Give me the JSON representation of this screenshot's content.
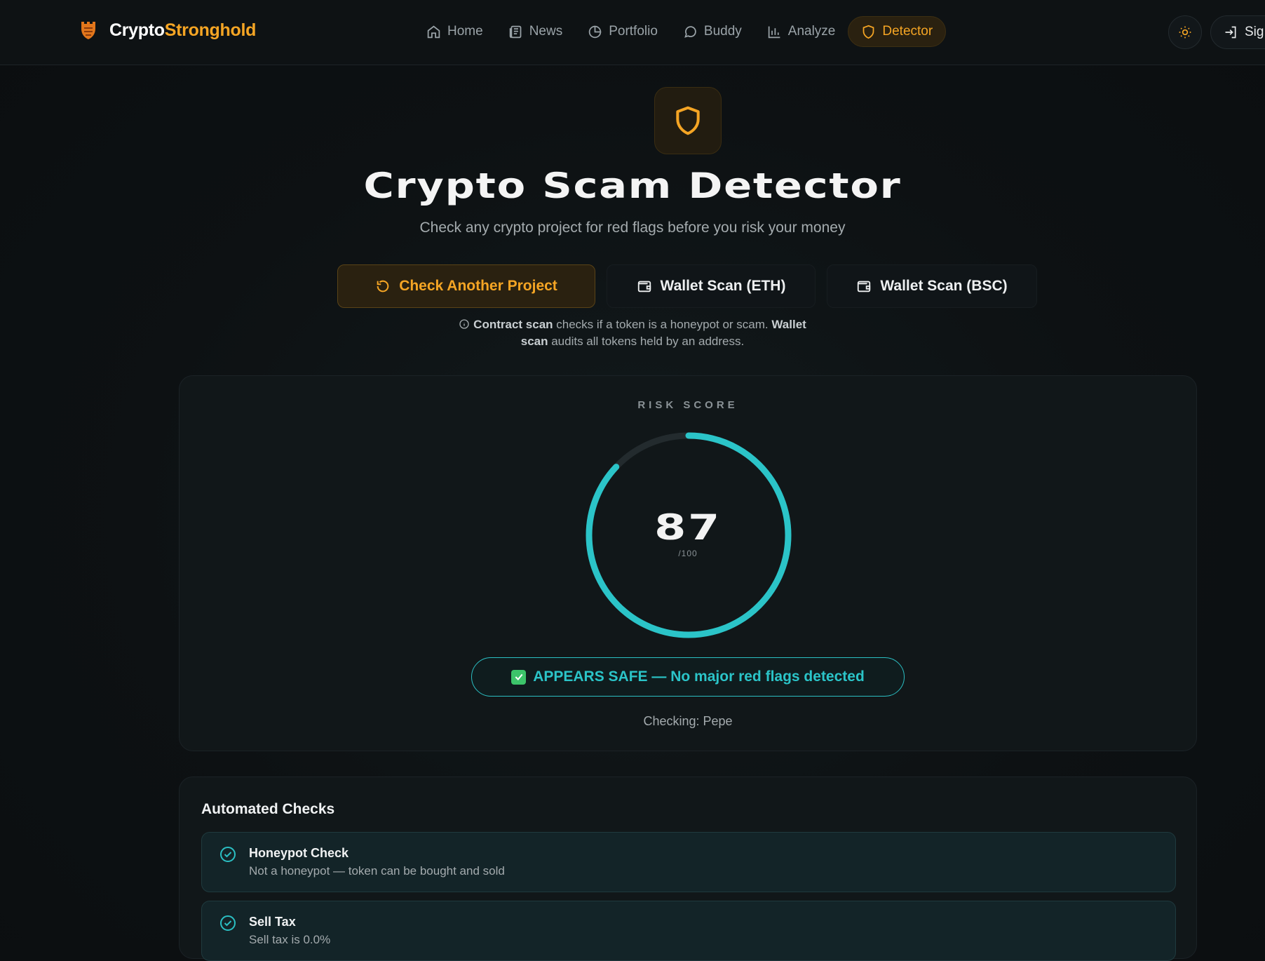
{
  "brand": {
    "name_part1": "Crypto",
    "name_part2": "Stronghold"
  },
  "nav": {
    "items": [
      {
        "label": "Home",
        "icon": "home-icon"
      },
      {
        "label": "News",
        "icon": "newspaper-icon"
      },
      {
        "label": "Portfolio",
        "icon": "pie-chart-icon"
      },
      {
        "label": "Buddy",
        "icon": "chat-bubble-icon"
      },
      {
        "label": "Analyze",
        "icon": "bar-chart-icon"
      },
      {
        "label": "Detector",
        "icon": "shield-icon",
        "active": true
      }
    ],
    "signin_label": "Sig"
  },
  "hero": {
    "title": "Crypto Scam Detector",
    "subtitle": "Check any crypto project for red flags before you risk your money"
  },
  "actions": {
    "check_another": "Check Another Project",
    "wallet_eth": "Wallet Scan (ETH)",
    "wallet_bsc": "Wallet Scan (BSC)"
  },
  "info_note": {
    "contract_bold": "Contract scan",
    "contract_text": " checks if a token is a honeypot or scam. ",
    "wallet_bold": "Wallet scan",
    "wallet_text": " audits all tokens held by an address."
  },
  "risk": {
    "label": "RISK SCORE",
    "score": "87",
    "score_value": 87,
    "max": "/100",
    "verdict": "APPEARS SAFE — No major red flags detected",
    "checking": "Checking: Pepe"
  },
  "checks": {
    "title": "Automated Checks",
    "items": [
      {
        "name": "Honeypot Check",
        "desc": "Not a honeypot — token can be bought and sold"
      },
      {
        "name": "Sell Tax",
        "desc": "Sell tax is 0.0%"
      }
    ]
  },
  "colors": {
    "accent": "#f5a524",
    "safe": "#2bc4c8",
    "background": "#0c0f11"
  }
}
